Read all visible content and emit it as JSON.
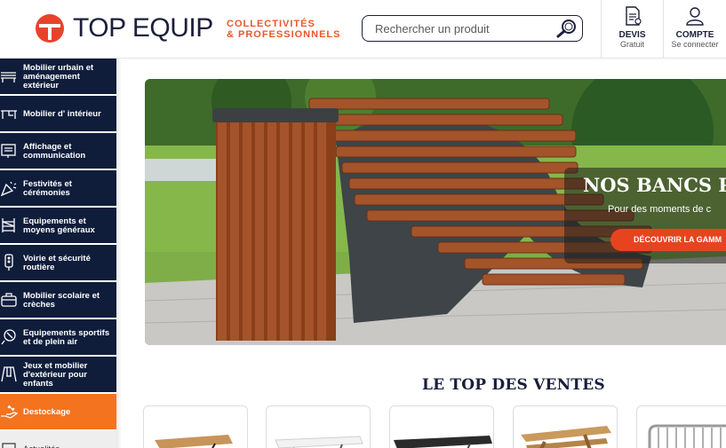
{
  "brand": {
    "name": "TOP EQUIP",
    "tagline_line1": "COLLECTIVITÉS",
    "tagline_line2": "& PROFESSIONNELS",
    "accent_color": "#e8582a"
  },
  "search": {
    "placeholder": "Rechercher un produit"
  },
  "header_actions": [
    {
      "label": "DEVIS",
      "sublabel": "Gratuit",
      "icon": "quote-document-icon"
    },
    {
      "label": "COMPTE",
      "sublabel": "Se connecter",
      "icon": "user-icon"
    }
  ],
  "sidebar": {
    "items": [
      {
        "label": "Mobilier urbain et aménagement extérieur",
        "icon": "bench-icon"
      },
      {
        "label": "Mobilier d' intérieur",
        "icon": "desk-icon"
      },
      {
        "label": "Affichage et communication",
        "icon": "display-board-icon"
      },
      {
        "label": "Festivités et cérémonies",
        "icon": "confetti-icon"
      },
      {
        "label": "Equipements et moyens généraux",
        "icon": "shelving-icon"
      },
      {
        "label": "Voirie et sécurité routière",
        "icon": "traffic-light-icon"
      },
      {
        "label": "Mobilier scolaire et crèches",
        "icon": "school-bag-icon"
      },
      {
        "label": "Equipements sportifs et de plein air",
        "icon": "sport-icon"
      },
      {
        "label": "Jeux et mobilier d'extérieur pour enfants",
        "icon": "swing-icon"
      },
      {
        "label": "Destockage",
        "icon": "discount-hand-icon"
      },
      {
        "label": "Actualités",
        "icon": "news-icon"
      }
    ],
    "active_color": "#f4731f",
    "base_color": "#0f1d3b"
  },
  "hero": {
    "title": "NOS BANCS PU",
    "subtitle": "Pour des moments de c",
    "cta": "DÉCOUVRIR LA GAMM"
  },
  "top_sales": {
    "title": "LE TOP DES VENTES",
    "products": [
      {
        "name": "wood-folding-table"
      },
      {
        "name": "white-folding-table"
      },
      {
        "name": "black-folding-table"
      },
      {
        "name": "wooden-picnic-table"
      },
      {
        "name": "crowd-barrier"
      }
    ]
  }
}
